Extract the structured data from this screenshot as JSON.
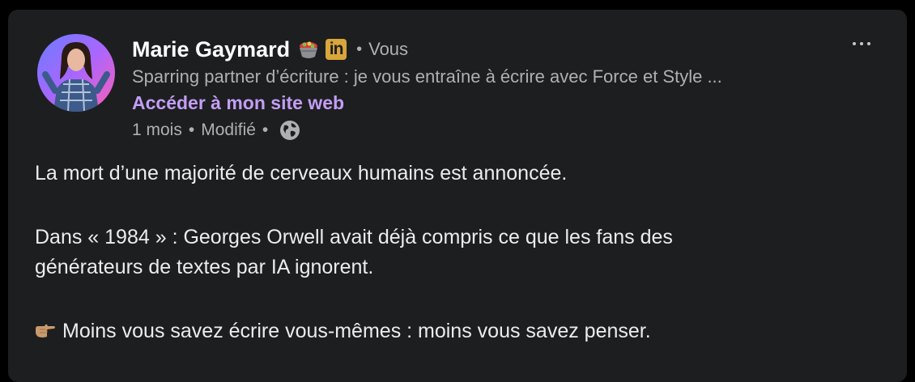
{
  "post": {
    "author": {
      "name": "Marie Gaymard",
      "badge_in": "in",
      "relation": "Vous",
      "relation_sep": "•",
      "headline": "Sparring partner d’écriture : je vous entraîne à écrire avec Force et Style ...",
      "website_link": "Accéder à mon site web"
    },
    "meta": {
      "age": "1 mois",
      "sep1": "•",
      "edited": "Modifié",
      "sep2": "•",
      "visibility_icon": "globe-icon"
    },
    "body": {
      "line1": "La mort d’une majorité de cerveaux humains est annoncée.",
      "line2": "Dans « 1984 » : Georges Orwell avait déjà compris ce que les fans des",
      "line3": "générateurs de textes par IA ignorent.",
      "line4": "Moins vous savez écrire vous-mêmes : moins vous savez penser."
    },
    "icons": {
      "more": "more-horizontal-icon",
      "bowl": "bowl-emoji-icon",
      "linkedin": "linkedin-badge-icon",
      "point": "pointing-right-hand-icon"
    }
  },
  "colors": {
    "card_bg": "#1d1e20",
    "link": "#c29ef5",
    "muted": "#b0b0b3",
    "linkedin_badge": "#d8a63a"
  }
}
